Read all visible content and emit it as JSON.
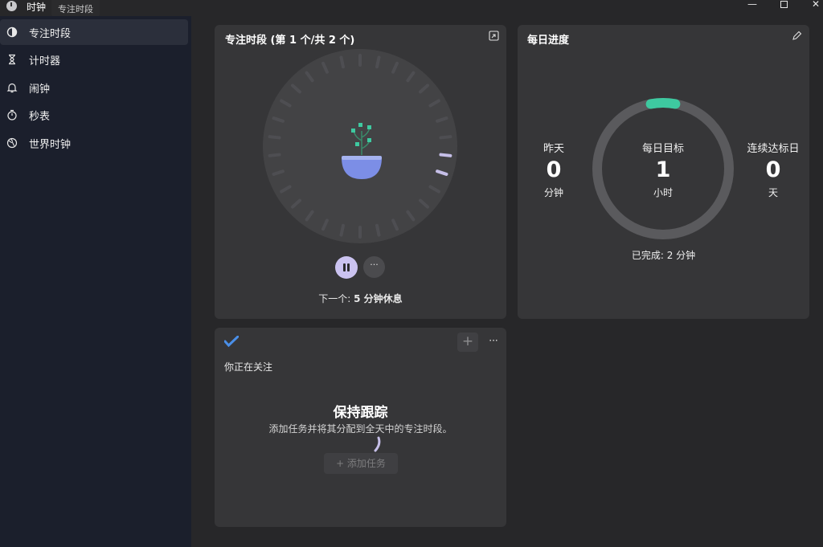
{
  "app": {
    "title": "时钟",
    "tooltip": "专注时段",
    "window_controls": {
      "minimize": "—",
      "close": "✕"
    }
  },
  "sidebar": {
    "items": [
      {
        "label": "专注时段",
        "icon": "focus-icon",
        "active": true
      },
      {
        "label": "计时器",
        "icon": "hourglass-icon",
        "active": false
      },
      {
        "label": "闹钟",
        "icon": "bell-icon",
        "active": false
      },
      {
        "label": "秒表",
        "icon": "stopwatch-icon",
        "active": false
      },
      {
        "label": "世界时钟",
        "icon": "globe-icon",
        "active": false
      }
    ]
  },
  "focus": {
    "title": "专注时段 (第 1 个/共 2 个)",
    "more_label": "···",
    "next_prefix": "下一个: ",
    "next_value": "5 分钟休息"
  },
  "progress": {
    "title": "每日进度",
    "yesterday": {
      "label": "昨天",
      "value": "0",
      "unit": "分钟"
    },
    "goal": {
      "label": "每日目标",
      "value": "1",
      "unit": "小时"
    },
    "streak": {
      "label": "连续达标日",
      "value": "0",
      "unit": "天"
    },
    "completed": "已完成: 2 分钟",
    "completed_fraction": 0.033,
    "accent_color": "#3ec9a0"
  },
  "tasks": {
    "add_icon_label": "+",
    "more_label": "···",
    "focusing": "你正在关注",
    "keep_title": "保持跟踪",
    "keep_sub": "添加任务并将其分配到全天中的专注时段。",
    "add_task": "+  添加任务"
  },
  "colors": {
    "sidebar_bg": "#1b1f2c",
    "card_bg": "#363638",
    "accent_purple": "#c6bfe8",
    "accent_teal": "#3ec9a0"
  }
}
